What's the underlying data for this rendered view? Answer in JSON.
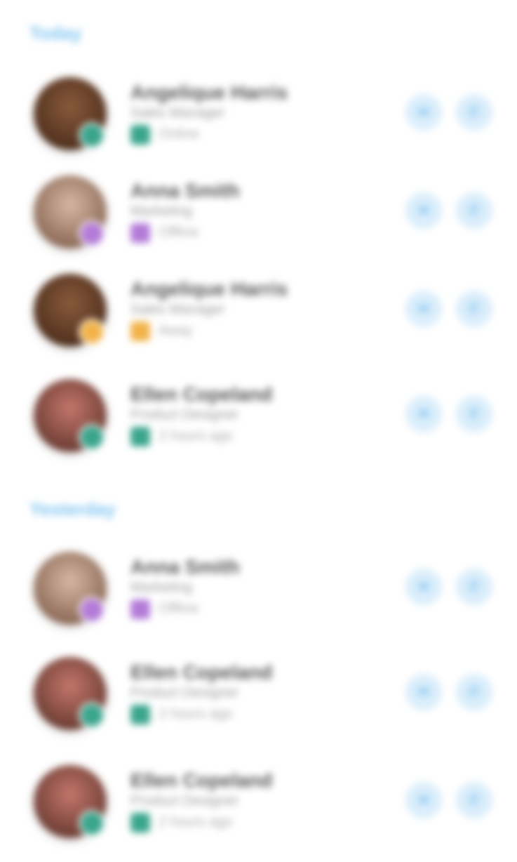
{
  "sections": [
    {
      "title": "Today"
    },
    {
      "title": "Yesterday"
    }
  ],
  "contacts": [
    {
      "name": "Angelique Harris",
      "role": "Sales Manager",
      "status": "Online",
      "status_color": "#3aa58c",
      "avatar_colors": [
        "#8a5a3b",
        "#4e2f1d"
      ]
    },
    {
      "name": "Anna Smith",
      "role": "Marketing",
      "status": "Offline",
      "status_color": "#b37bd8",
      "avatar_colors": [
        "#d8b8a4",
        "#8a6855"
      ]
    },
    {
      "name": "Angelique Harris",
      "role": "Sales Manager",
      "status": "Away",
      "status_color": "#f2b34a",
      "avatar_colors": [
        "#8a5a3b",
        "#4e2f1d"
      ]
    },
    {
      "name": "Ellen Copeland",
      "role": "Product Designer",
      "status": "2 hours ago",
      "status_color": "#3aa58c",
      "avatar_colors": [
        "#c4766b",
        "#6b3c33"
      ]
    },
    {
      "name": "Anna Smith",
      "role": "Marketing",
      "status": "Offline",
      "status_color": "#b37bd8",
      "avatar_colors": [
        "#d8b8a4",
        "#8a6855"
      ]
    },
    {
      "name": "Ellen Copeland",
      "role": "Product Designer",
      "status": "2 hours ago",
      "status_color": "#3aa58c",
      "avatar_colors": [
        "#c4766b",
        "#6b3c33"
      ]
    },
    {
      "name": "Ellen Copeland",
      "role": "Product Designer",
      "status": "2 hours ago",
      "status_color": "#3aa58c",
      "avatar_colors": [
        "#c4766b",
        "#6b3c33"
      ]
    }
  ],
  "icons": {
    "chat": "chat-icon",
    "call": "phone-icon"
  }
}
